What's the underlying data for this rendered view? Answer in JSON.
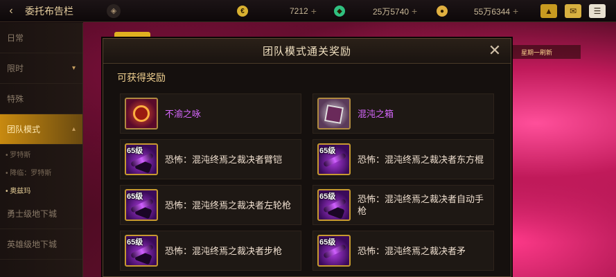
{
  "topbar": {
    "back_symbol": "‹",
    "title": "委托布告栏",
    "currencies": [
      {
        "icon": "gold-coin-icon",
        "value": "7212",
        "color": "#d8b030"
      },
      {
        "icon": "green-gem-icon",
        "value": "25万5740",
        "color": "#30c080"
      },
      {
        "icon": "gold-orb-icon",
        "value": "55万6344",
        "color": "#e0b040"
      }
    ],
    "plus": "+"
  },
  "sidebar": {
    "items": [
      {
        "label": "日常",
        "active": false
      },
      {
        "label": "限时",
        "active": false
      },
      {
        "label": "特殊",
        "active": false
      },
      {
        "label": "团队模式",
        "active": true
      }
    ],
    "subitems": [
      {
        "label": "• 罗特斯",
        "active": false
      },
      {
        "label": "• 降临：罗特斯",
        "active": false
      },
      {
        "label": "• 奥兹玛",
        "active": true
      }
    ],
    "more_items": [
      {
        "label": "勇士级地下城"
      },
      {
        "label": "英雄级地下城"
      }
    ]
  },
  "background": {
    "banner_text": "星期一刷新"
  },
  "modal": {
    "title": "团队模式通关奖励",
    "close_symbol": "✕",
    "section_title": "可获得奖励",
    "rewards": [
      {
        "name": "不渝之咏",
        "level": "",
        "style": "purple",
        "icon": "unique-orb-icon"
      },
      {
        "name": "混沌之箱",
        "level": "",
        "style": "purple",
        "icon": "box-icon"
      },
      {
        "name": "恐怖：混沌终焉之裁决者臂铠",
        "level": "65级",
        "style": "normal",
        "icon": "arm-blade-icon"
      },
      {
        "name": "恐怖：混沌终焉之裁决者东方棍",
        "level": "65级",
        "style": "normal",
        "icon": "staff-icon"
      },
      {
        "name": "恐怖：混沌终焉之裁决者左轮枪",
        "level": "65级",
        "style": "normal",
        "icon": "revolver-icon"
      },
      {
        "name": "恐怖：混沌终焉之裁决者自动手枪",
        "level": "65级",
        "style": "normal",
        "icon": "pistol-icon"
      },
      {
        "name": "恐怖：混沌终焉之裁决者步枪",
        "level": "65级",
        "style": "normal",
        "icon": "rifle-icon"
      },
      {
        "name": "恐怖：混沌终焉之裁决者矛",
        "level": "65级",
        "style": "normal",
        "icon": "spear-icon"
      }
    ]
  }
}
